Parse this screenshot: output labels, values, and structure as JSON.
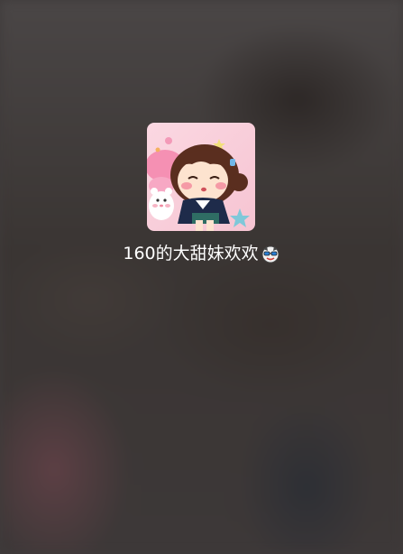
{
  "profile": {
    "nickname": "160的大甜妹欢欢",
    "avatar_icon": "cartoon-girl-avatar",
    "emoji_icon": "cool-face-emoji"
  },
  "colors": {
    "backdrop": "#3f3b3b",
    "text": "#ffffff",
    "avatar_bg": "#f9d3dc"
  }
}
